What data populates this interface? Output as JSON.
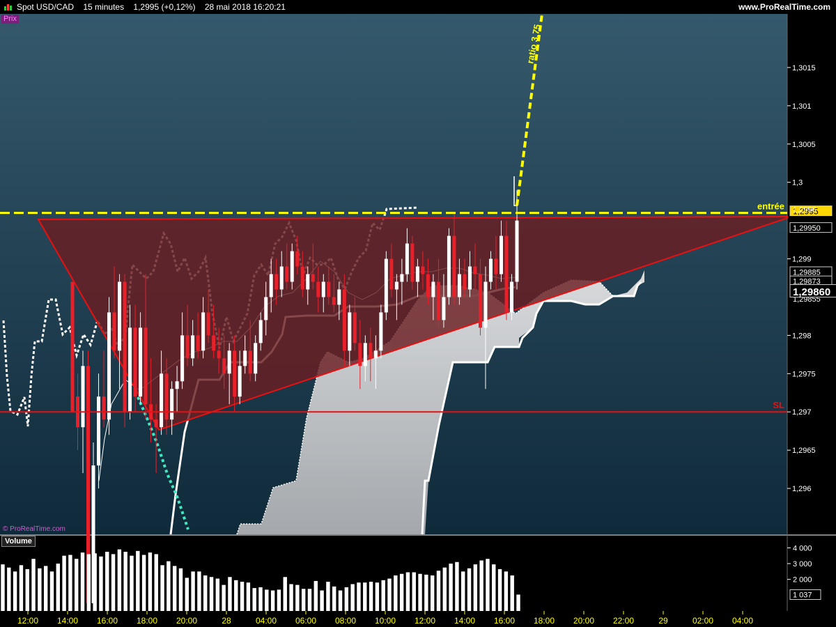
{
  "header": {
    "instrument": "Spot USD/CAD",
    "interval": "15 minutes",
    "last": "1,2995 (+0,12%)",
    "datetime": "28 mai 2018 16:20:21",
    "site": "www.ProRealTime.com",
    "prix_label": "Prix",
    "copyright": "© ProRealTime.com",
    "volume_label": "Volume"
  },
  "colors": {
    "bg_top": "#35596c",
    "bg_bottom": "#0f2a3a",
    "bull": "#ffffff",
    "bear": "#e8202a",
    "level_yellow": "#ffff00",
    "sl_red": "#e81010",
    "cloud": "#c0c4c8",
    "triangle_fill": "#6a1e22"
  },
  "chart_data": {
    "type": "candlestick",
    "price_axis": {
      "ylim": [
        1.2954,
        1.3022
      ],
      "ticks": [
        {
          "value": 1.3015,
          "label": "1,3015"
        },
        {
          "value": 1.301,
          "label": "1,301"
        },
        {
          "value": 1.3005,
          "label": "1,3005"
        },
        {
          "value": 1.3,
          "label": "1,3"
        },
        {
          "value": 1.299,
          "label": "1,299"
        },
        {
          "value": 1.298,
          "label": "1,298"
        },
        {
          "value": 1.2975,
          "label": "1,2975"
        },
        {
          "value": 1.297,
          "label": "1,297"
        },
        {
          "value": 1.2965,
          "label": "1,2965"
        },
        {
          "value": 1.296,
          "label": "1,296"
        }
      ],
      "markers": [
        {
          "value": 1.2995,
          "label": "1,2995",
          "style": "highlight"
        },
        {
          "value": 1.29963,
          "label": "1,2996",
          "style": "plain"
        },
        {
          "value": 1.2995,
          "label": "1,29950",
          "style": "box"
        },
        {
          "value": 1.29885,
          "label": "1,29885",
          "style": "box"
        },
        {
          "value": 1.29873,
          "label": "1,29873",
          "style": "box"
        },
        {
          "value": 1.2986,
          "label": "1,29860",
          "style": "big"
        },
        {
          "value": 1.29855,
          "label": "1,29855",
          "style": "plain"
        }
      ]
    },
    "levels": [
      {
        "name": "entrée",
        "value": 1.2996,
        "color": "#ffff00",
        "dashed": true
      },
      {
        "name": "SL",
        "value": 1.297,
        "color": "#e81010",
        "dashed": false
      }
    ],
    "annotation": {
      "text": "ratio 3,75"
    },
    "x_axis": {
      "labels": [
        "12:00",
        "14:00",
        "16:00",
        "18:00",
        "20:00",
        "28",
        "04:00",
        "06:00",
        "08:00",
        "10:00",
        "12:00",
        "14:00",
        "16:00",
        "18:00",
        "20:00",
        "22:00",
        "29",
        "02:00",
        "04:00"
      ]
    },
    "volume_axis": {
      "ylim": [
        0,
        4500
      ],
      "ticks": [
        {
          "value": 4000,
          "label": "4 000"
        },
        {
          "value": 3000,
          "label": "3 000"
        },
        {
          "value": 2000,
          "label": "2 000"
        }
      ],
      "last": {
        "value": 1037,
        "label": "1 037"
      }
    },
    "candles": [
      [
        1.2987,
        1.2985,
        1.2972,
        1.297
      ],
      [
        1.2972,
        1.2975,
        1.2965,
        1.2968
      ],
      [
        1.2968,
        1.2978,
        1.2962,
        1.2976
      ],
      [
        1.2976,
        1.2978,
        1.294,
        1.2945
      ],
      [
        1.2945,
        1.2966,
        1.2944,
        1.2963
      ],
      [
        1.2963,
        1.2975,
        1.296,
        1.2972
      ],
      [
        1.2972,
        1.2978,
        1.2968,
        1.2969
      ],
      [
        1.2969,
        1.2985,
        1.2967,
        1.2983
      ],
      [
        1.2983,
        1.2989,
        1.2977,
        1.2978
      ],
      [
        1.2978,
        1.2988,
        1.2973,
        1.2987
      ],
      [
        1.2987,
        1.2988,
        1.2968,
        1.297
      ],
      [
        1.297,
        1.2984,
        1.2969,
        1.2981
      ],
      [
        1.2981,
        1.2984,
        1.297,
        1.2972
      ],
      [
        1.2972,
        1.2983,
        1.2971,
        1.2981
      ],
      [
        1.2981,
        1.2988,
        1.2969,
        1.2971
      ],
      [
        1.2971,
        1.2977,
        1.2966,
        1.2969
      ],
      [
        1.2969,
        1.2971,
        1.2962,
        1.2968
      ],
      [
        1.2968,
        1.2978,
        1.2967,
        1.2975
      ],
      [
        1.2975,
        1.2977,
        1.2967,
        1.2969
      ],
      [
        1.2969,
        1.2974,
        1.2967,
        1.2973
      ],
      [
        1.2973,
        1.2976,
        1.297,
        1.2974
      ],
      [
        1.2974,
        1.2983,
        1.2973,
        1.298
      ],
      [
        1.298,
        1.2984,
        1.2976,
        1.2977
      ],
      [
        1.2977,
        1.2982,
        1.2976,
        1.298
      ],
      [
        1.298,
        1.2983,
        1.2977,
        1.2978
      ],
      [
        1.2978,
        1.2985,
        1.2977,
        1.2983
      ],
      [
        1.2983,
        1.2986,
        1.2979,
        1.298
      ],
      [
        1.298,
        1.2984,
        1.2977,
        1.2978
      ],
      [
        1.2978,
        1.2981,
        1.2975,
        1.2977
      ],
      [
        1.2977,
        1.298,
        1.2973,
        1.2975
      ],
      [
        1.2975,
        1.2979,
        1.2971,
        1.2978
      ],
      [
        1.2978,
        1.298,
        1.297,
        1.2972
      ],
      [
        1.2972,
        1.2978,
        1.2971,
        1.2976
      ],
      [
        1.2976,
        1.298,
        1.2975,
        1.2978
      ],
      [
        1.2978,
        1.2982,
        1.2974,
        1.2975
      ],
      [
        1.2975,
        1.298,
        1.2974,
        1.2979
      ],
      [
        1.2979,
        1.2983,
        1.2978,
        1.2982
      ],
      [
        1.2982,
        1.2987,
        1.298,
        1.2985
      ],
      [
        1.2985,
        1.299,
        1.2983,
        1.2988
      ],
      [
        1.2988,
        1.299,
        1.2984,
        1.2986
      ],
      [
        1.2986,
        1.2991,
        1.2985,
        1.2989
      ],
      [
        1.2989,
        1.2992,
        1.2986,
        1.2987
      ],
      [
        1.2987,
        1.2992,
        1.2986,
        1.2991
      ],
      [
        1.2991,
        1.2993,
        1.2988,
        1.2989
      ],
      [
        1.2989,
        1.2991,
        1.2985,
        1.2986
      ],
      [
        1.2986,
        1.2989,
        1.2984,
        1.2988
      ],
      [
        1.2988,
        1.2992,
        1.2986,
        1.2987
      ],
      [
        1.2987,
        1.2989,
        1.2983,
        1.2985
      ],
      [
        1.2985,
        1.2988,
        1.2983,
        1.2987
      ],
      [
        1.2987,
        1.2989,
        1.2984,
        1.2985
      ],
      [
        1.2985,
        1.2988,
        1.2983,
        1.2984
      ],
      [
        1.2984,
        1.2987,
        1.2982,
        1.2986
      ],
      [
        1.2986,
        1.2988,
        1.2976,
        1.2978
      ],
      [
        1.2978,
        1.2984,
        1.2976,
        1.2983
      ],
      [
        1.2983,
        1.2985,
        1.2978,
        1.2979
      ],
      [
        1.2979,
        1.2982,
        1.2973,
        1.2976
      ],
      [
        1.2976,
        1.298,
        1.2974,
        1.2979
      ],
      [
        1.2979,
        1.2981,
        1.2974,
        1.2977
      ],
      [
        1.2977,
        1.298,
        1.2973,
        1.2978
      ],
      [
        1.2978,
        1.2984,
        1.2977,
        1.2983
      ],
      [
        1.2983,
        1.2991,
        1.2982,
        1.299
      ],
      [
        1.299,
        1.2992,
        1.2985,
        1.2986
      ],
      [
        1.2986,
        1.2988,
        1.2982,
        1.2987
      ],
      [
        1.2987,
        1.299,
        1.2984,
        1.2988
      ],
      [
        1.2988,
        1.2994,
        1.2987,
        1.2992
      ],
      [
        1.2992,
        1.2993,
        1.2986,
        1.2987
      ],
      [
        1.2987,
        1.299,
        1.2985,
        1.2989
      ],
      [
        1.2989,
        1.2991,
        1.2986,
        1.2988
      ],
      [
        1.2988,
        1.299,
        1.2984,
        1.2985
      ],
      [
        1.2985,
        1.2988,
        1.2982,
        1.2987
      ],
      [
        1.2987,
        1.299,
        1.2981,
        1.2982
      ],
      [
        1.2982,
        1.2988,
        1.2981,
        1.2985
      ],
      [
        1.2985,
        1.2994,
        1.2984,
        1.2993
      ],
      [
        1.2993,
        1.2996,
        1.2984,
        1.2985
      ],
      [
        1.2985,
        1.299,
        1.2984,
        1.2988
      ],
      [
        1.2988,
        1.299,
        1.2985,
        1.2986
      ],
      [
        1.2986,
        1.2991,
        1.2985,
        1.2989
      ],
      [
        1.2989,
        1.2992,
        1.2986,
        1.2988
      ],
      [
        1.2988,
        1.299,
        1.298,
        1.2981
      ],
      [
        1.2981,
        1.2989,
        1.2973,
        1.2987
      ],
      [
        1.2987,
        1.2991,
        1.2986,
        1.299
      ],
      [
        1.299,
        1.2993,
        1.2986,
        1.2988
      ],
      [
        1.2988,
        1.2995,
        1.2987,
        1.2993
      ],
      [
        1.2993,
        1.2995,
        1.2982,
        1.2983
      ],
      [
        1.2983,
        1.2988,
        1.2982,
        1.2987
      ],
      [
        1.2987,
        1.2999,
        1.2986,
        1.2995
      ]
    ],
    "volume": [
      2950,
      2750,
      2500,
      2900,
      2650,
      3300,
      2700,
      2850,
      2500,
      3000,
      3500,
      3550,
      3300,
      3700,
      3600,
      3650,
      3450,
      3750,
      3600,
      3900,
      3750,
      3500,
      3800,
      3550,
      3700,
      3600,
      2900,
      3150,
      2850,
      2700,
      2100,
      2500,
      2500,
      2250,
      2150,
      2050,
      1650,
      2150,
      1950,
      1850,
      1800,
      1450,
      1500,
      1350,
      1300,
      1350,
      2150,
      1700,
      1650,
      1400,
      1400,
      1900,
      1300,
      1850,
      1550,
      1300,
      1500,
      1700,
      1800,
      1800,
      1850,
      1800,
      1950,
      2050,
      2250,
      2350,
      2450,
      2450,
      2350,
      2300,
      2250,
      2550,
      2750,
      3000,
      3100,
      2500,
      2700,
      2950,
      3200,
      3300,
      2950,
      2650,
      2500,
      2250,
      1037
    ]
  }
}
